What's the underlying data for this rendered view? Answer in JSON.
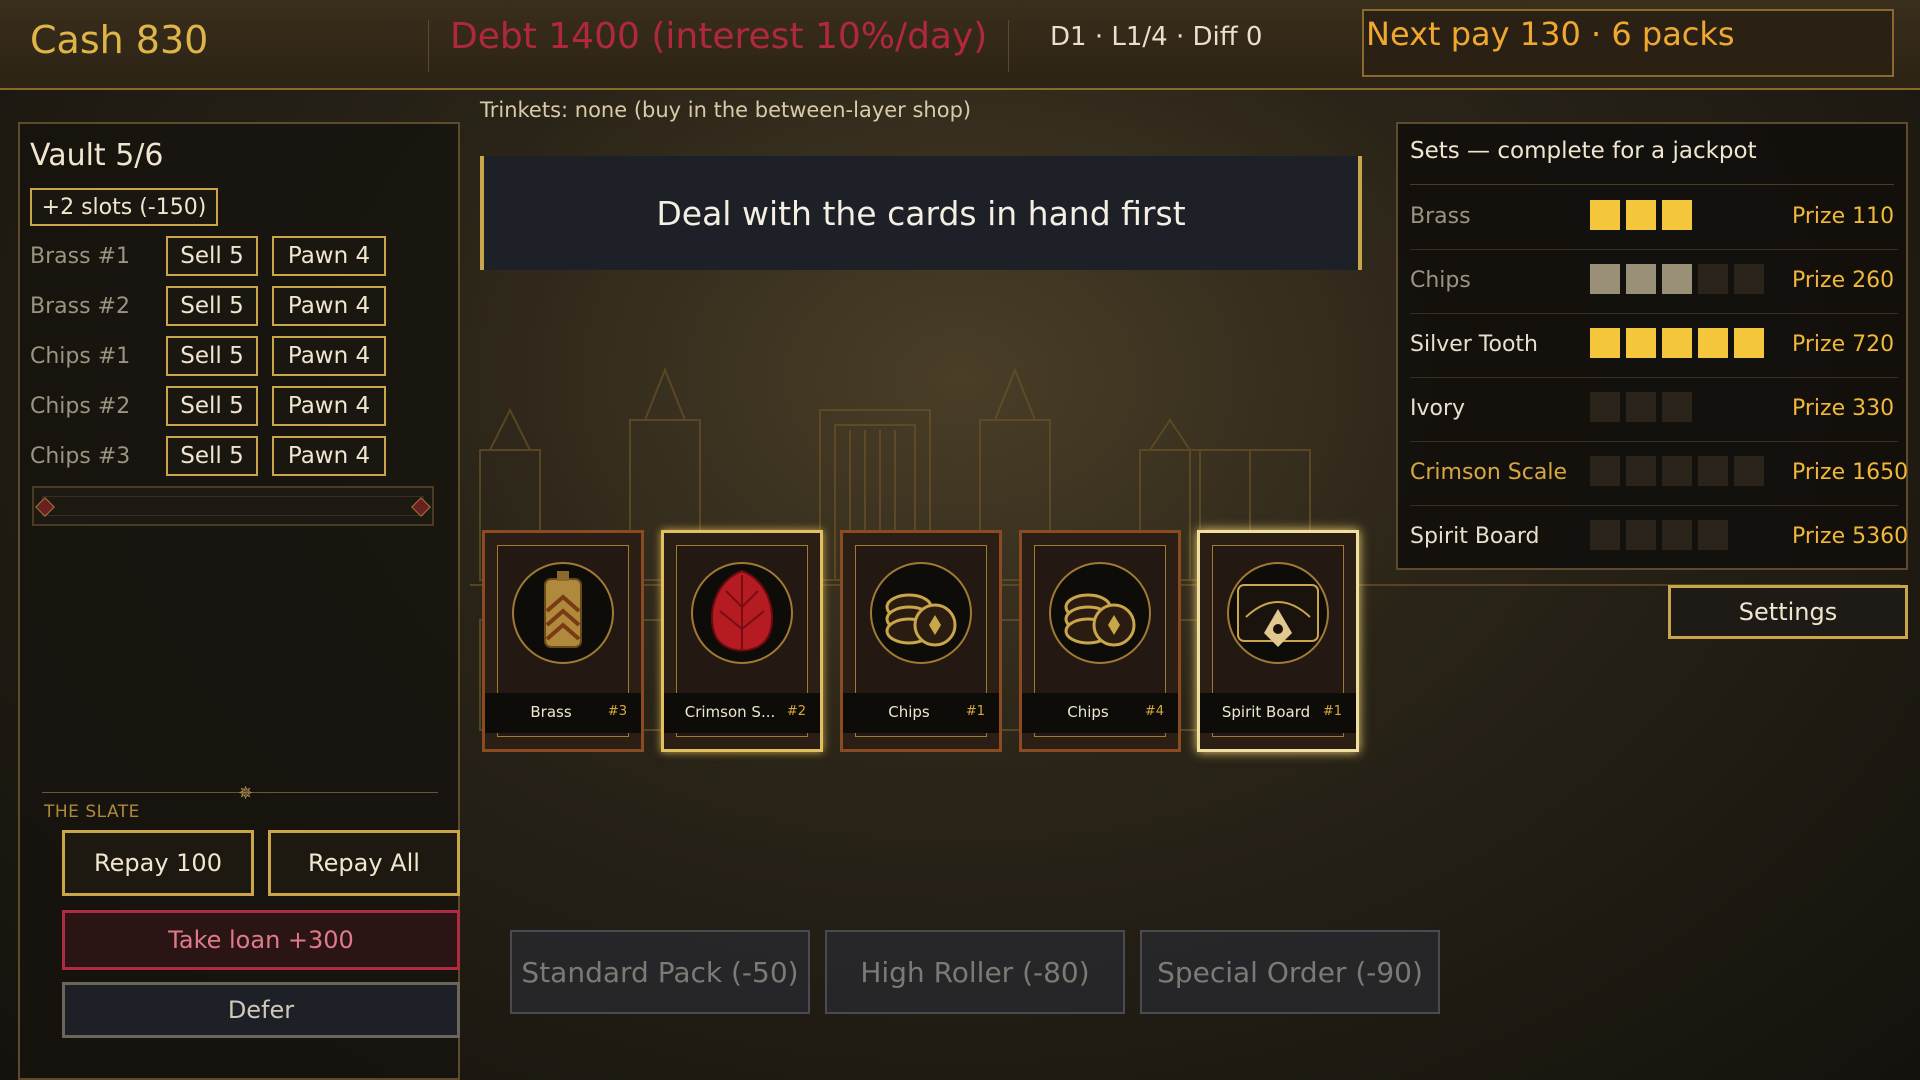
{
  "topbar": {
    "cash": "Cash 830",
    "debt": "Debt 1400 (interest 10%/day)",
    "day_info": "D1 · L1/4 · Diff 0",
    "next_pay": "Next pay 130 · 6 packs"
  },
  "trinkets": "Trinkets: none (buy in the between-layer shop)",
  "banner": "Deal with the cards in hand first",
  "vault": {
    "title": "Vault 5/6",
    "slots_button": "+2 slots (-150)",
    "rows": [
      {
        "label": "Brass #1",
        "sell": "Sell 5",
        "pawn": "Pawn 4"
      },
      {
        "label": "Brass #2",
        "sell": "Sell 5",
        "pawn": "Pawn 4"
      },
      {
        "label": "Chips #1",
        "sell": "Sell 5",
        "pawn": "Pawn 4"
      },
      {
        "label": "Chips #2",
        "sell": "Sell 5",
        "pawn": "Pawn 4"
      },
      {
        "label": "Chips #3",
        "sell": "Sell 5",
        "pawn": "Pawn 4"
      }
    ]
  },
  "slate": {
    "label": "THE SLATE",
    "repay_100": "Repay 100",
    "repay_all": "Repay All",
    "take_loan": "Take loan +300",
    "defer": "Defer"
  },
  "hand": [
    {
      "name": "Brass",
      "num": "#3",
      "icon": "brass-flask-icon"
    },
    {
      "name": "Crimson S...",
      "num": "#2",
      "icon": "crimson-scale-icon"
    },
    {
      "name": "Chips",
      "num": "#1",
      "icon": "poker-chips-icon"
    },
    {
      "name": "Chips",
      "num": "#4",
      "icon": "poker-chips-icon"
    },
    {
      "name": "Spirit Board",
      "num": "#1",
      "icon": "spirit-board-icon"
    }
  ],
  "shop": {
    "standard": "Standard Pack (-50)",
    "high_roller": "High Roller (-80)",
    "special": "Special Order (-90)"
  },
  "sets": {
    "title": "Sets — complete for a jackpot",
    "rows": [
      {
        "name": "Brass",
        "prize": "Prize 110",
        "pips": [
          "on",
          "on",
          "on"
        ],
        "name_color": "#9c9480"
      },
      {
        "name": "Chips",
        "prize": "Prize 260",
        "pips": [
          "gray",
          "gray",
          "gray",
          "off",
          "off"
        ],
        "name_color": "#9c9480"
      },
      {
        "name": "Silver Tooth",
        "prize": "Prize 720",
        "pips": [
          "on",
          "on",
          "on",
          "on",
          "on"
        ],
        "name_color": "#e8e0cc"
      },
      {
        "name": "Ivory",
        "prize": "Prize 330",
        "pips": [
          "off",
          "off",
          "off"
        ],
        "name_color": "#e8e0cc"
      },
      {
        "name": "Crimson Scale",
        "prize": "Prize 1650",
        "pips": [
          "off",
          "off",
          "off",
          "off",
          "off"
        ],
        "name_color": "#d8a840"
      },
      {
        "name": "Spirit Board",
        "prize": "Prize 5360",
        "pips": [
          "off",
          "off",
          "off",
          "off"
        ],
        "name_color": "#e8e0cc"
      }
    ]
  },
  "settings": "Settings",
  "colors": {
    "accent_gold": "#c9a64a",
    "debt_red": "#b0283a",
    "pip_gold": "#f4c63c"
  }
}
